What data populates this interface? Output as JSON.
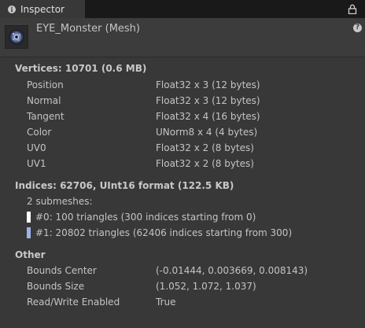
{
  "tab": {
    "title": "Inspector",
    "icon": "info-icon"
  },
  "toolbar": {
    "lock_icon": "lock-icon"
  },
  "header": {
    "title": "EYE_Monster (Mesh)",
    "help_icon": "help-icon"
  },
  "vertices": {
    "title": "Vertices: 10701 (0.6 MB)",
    "attributes": [
      {
        "name": "Position",
        "format": "Float32 x 3 (12 bytes)"
      },
      {
        "name": "Normal",
        "format": "Float32 x 3 (12 bytes)"
      },
      {
        "name": "Tangent",
        "format": "Float32 x 4 (16 bytes)"
      },
      {
        "name": "Color",
        "format": "UNorm8 x 4 (4 bytes)"
      },
      {
        "name": "UV0",
        "format": "Float32 x 2 (8 bytes)"
      },
      {
        "name": "UV1",
        "format": "Float32 x 2 (8 bytes)"
      }
    ]
  },
  "indices": {
    "title": "Indices: 62706, UInt16 format (122.5 KB)",
    "submesh_count_label": "2 submeshes:",
    "submeshes": [
      {
        "label": "#0: 100 triangles (300 indices starting from 0)",
        "color": "#ffffff"
      },
      {
        "label": "#1: 20802 triangles (62406 indices starting from 300)",
        "color": "#9fb4e6"
      }
    ]
  },
  "other": {
    "title": "Other",
    "rows": [
      {
        "name": "Bounds Center",
        "value": "(-0.01444, 0.003669, 0.008143)"
      },
      {
        "name": "Bounds Size",
        "value": "(1.052, 1.072, 1.037)"
      },
      {
        "name": "Read/Write Enabled",
        "value": "True"
      }
    ]
  }
}
